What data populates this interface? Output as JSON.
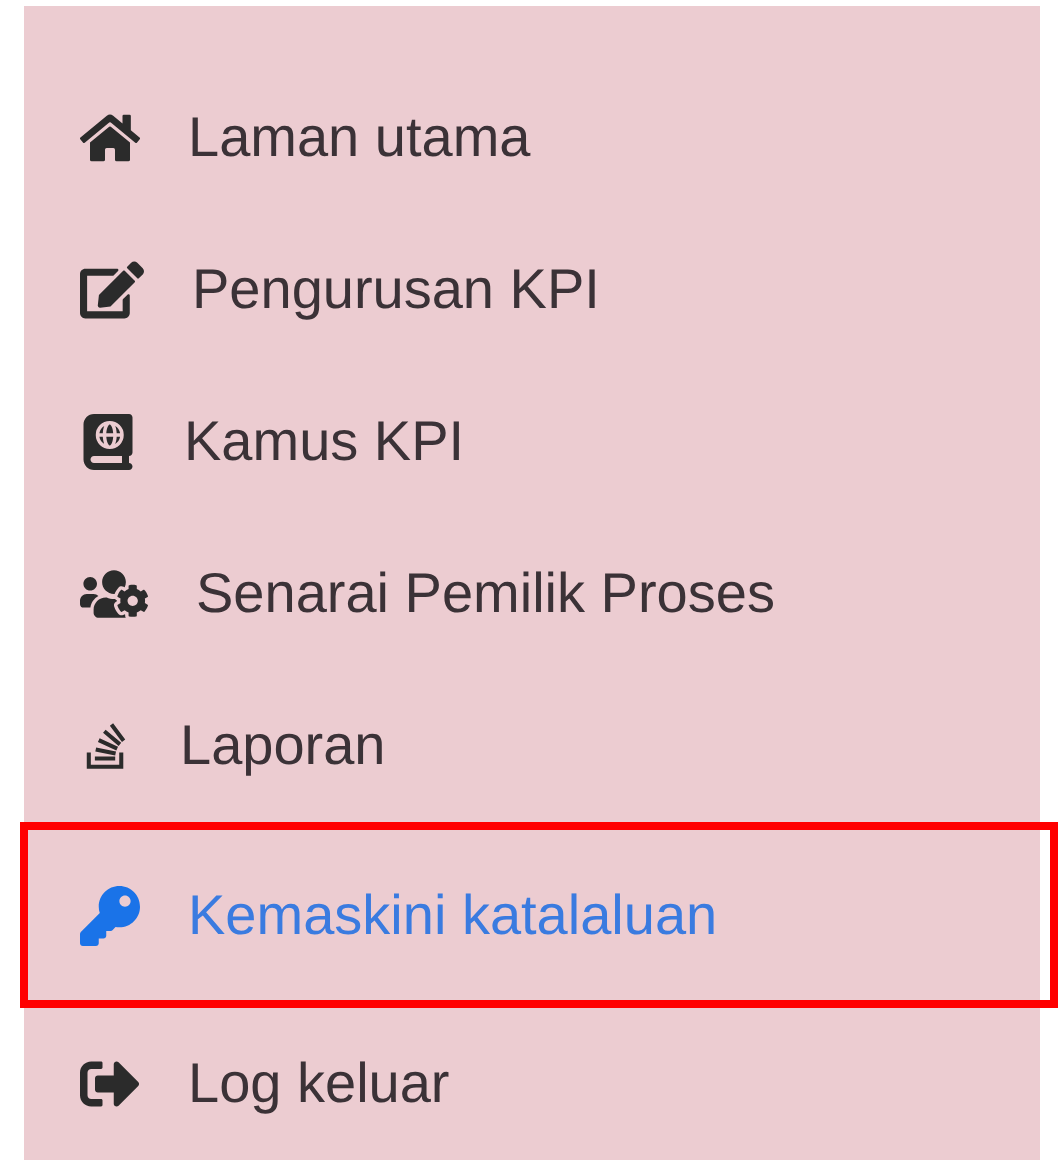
{
  "menu": {
    "items": [
      {
        "label": "Laman utama",
        "selected": false
      },
      {
        "label": "Pengurusan KPI",
        "selected": false
      },
      {
        "label": "Kamus KPI",
        "selected": false
      },
      {
        "label": "Senarai Pemilik Proses",
        "selected": false
      },
      {
        "label": "Laporan",
        "selected": false
      },
      {
        "label": "Kemaskini katalaluan",
        "selected": true
      },
      {
        "label": "Log keluar",
        "selected": false
      }
    ]
  }
}
